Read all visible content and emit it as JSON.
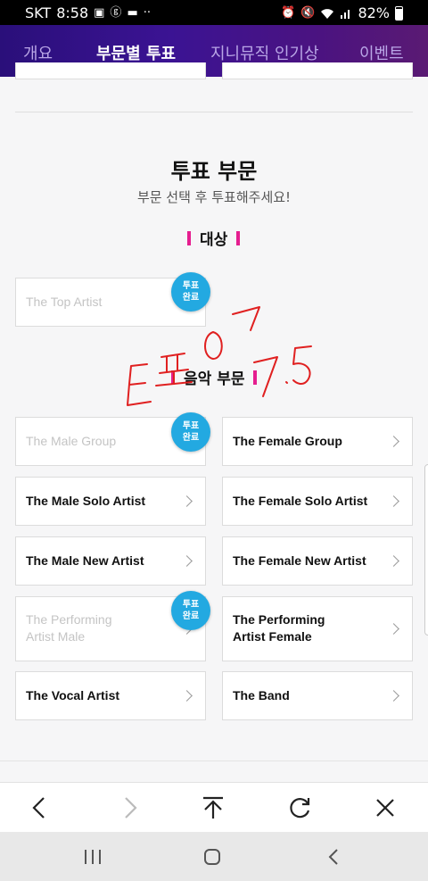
{
  "status_bar": {
    "carrier": "SKT",
    "time": "8:58",
    "battery": "82%",
    "left_icons": [
      "image-icon",
      "g-app-icon",
      "message-icon",
      "more-dots-icon"
    ],
    "right_icons": [
      "alarm-icon",
      "mute-icon",
      "wifi-icon",
      "signal-icon",
      "battery-icon"
    ]
  },
  "tabs": [
    {
      "label": "개요",
      "active": false
    },
    {
      "label": "부문별 투표",
      "active": true
    },
    {
      "label": "지니뮤직 인기상",
      "active": false
    },
    {
      "label": "이벤트",
      "active": false
    }
  ],
  "vote_section": {
    "title": "투표 부문",
    "subtitle": "부문 선택 후 투표해주세요!"
  },
  "grand_prize": {
    "heading": "대상",
    "items": [
      {
        "label": "The Top Artist",
        "voted": true,
        "badge": [
          "투표",
          "완료"
        ]
      }
    ]
  },
  "music_section": {
    "heading": "음악 부문",
    "items": [
      {
        "label": "The Male Group",
        "voted": true,
        "badge": [
          "투표",
          "완료"
        ]
      },
      {
        "label": "The Female Group",
        "voted": false
      },
      {
        "label": "The Male Solo Artist",
        "voted": false
      },
      {
        "label": "The Female Solo Artist",
        "voted": false
      },
      {
        "label": "The Male New Artist",
        "voted": false
      },
      {
        "label": "The Female New Artist",
        "voted": false
      },
      {
        "label_lines": [
          "The Performing",
          "Artist Male"
        ],
        "voted": true,
        "badge": [
          "투표",
          "완료"
        ]
      },
      {
        "label_lines": [
          "The Performing",
          "Artist Female"
        ],
        "voted": false
      },
      {
        "label": "The Vocal Artist",
        "voted": false
      },
      {
        "label": "The Band",
        "voted": false
      }
    ]
  },
  "handwritten_annotation": "E 표 07 7.5",
  "colors": {
    "tab_bar_start": "#2a0f7a",
    "tab_bar_end": "#5a1a73",
    "badge_blue": "#23a9e1",
    "accent_pink": "#e51e8f",
    "annotation_red": "#e02020"
  },
  "browser_toolbar": [
    "back-icon",
    "forward-icon",
    "scroll-top-icon",
    "refresh-icon",
    "close-icon"
  ],
  "system_nav": [
    "recent-apps-icon",
    "home-icon",
    "back-nav-icon"
  ]
}
